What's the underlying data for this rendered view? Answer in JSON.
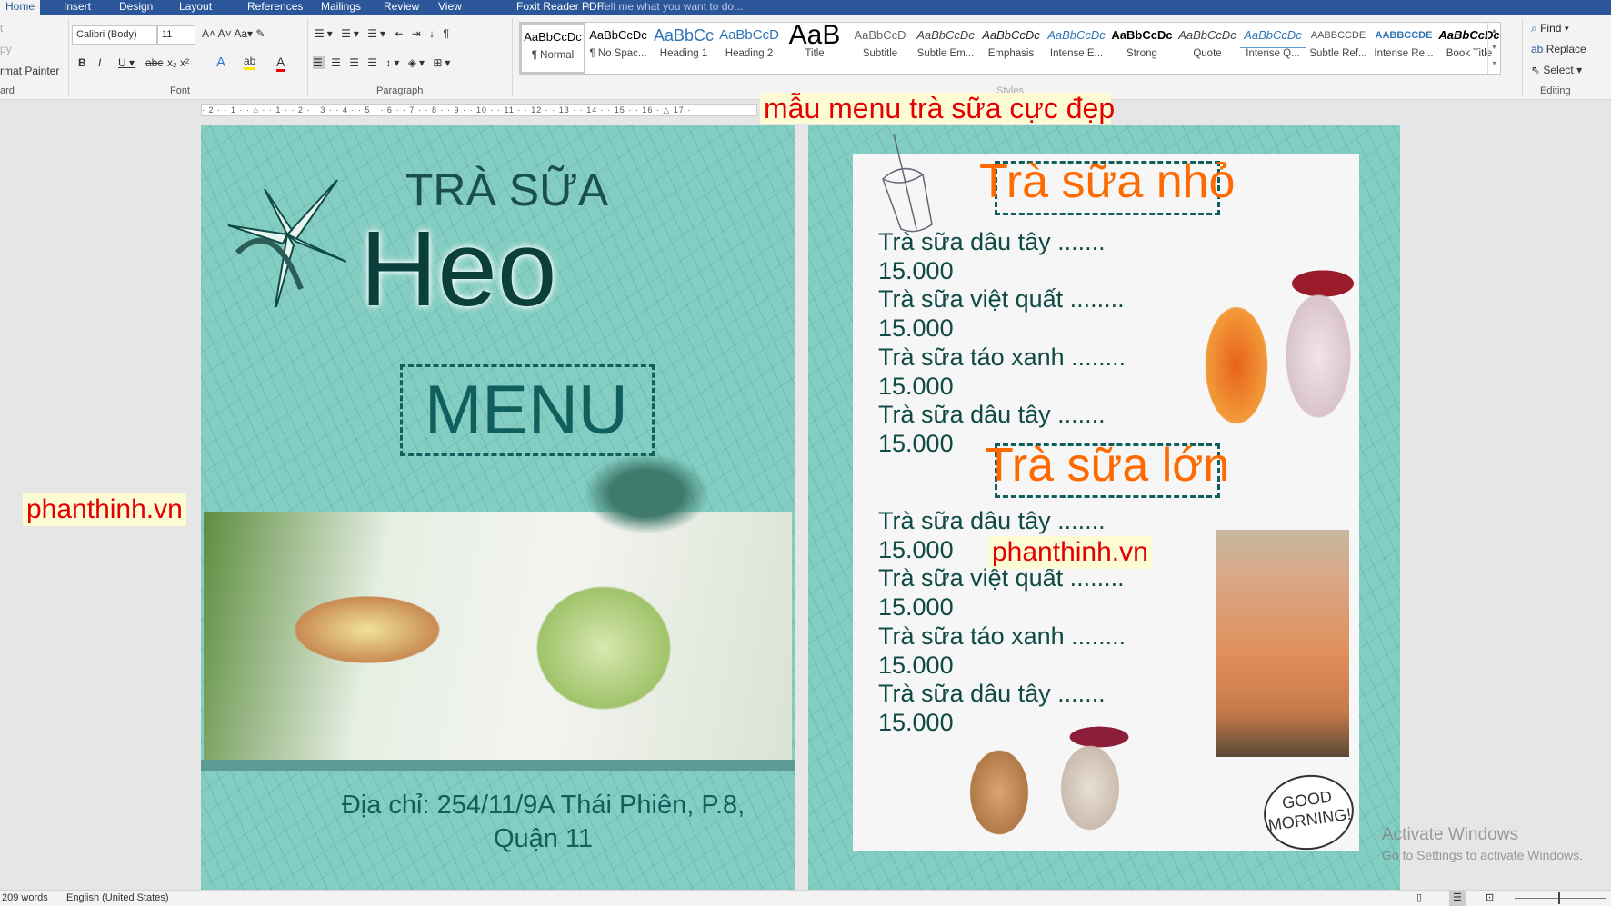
{
  "tabs": [
    "Home",
    "Insert",
    "Design",
    "Layout",
    "References",
    "Mailings",
    "Review",
    "View",
    "Foxit Reader PDF"
  ],
  "tell_me": "Tell me what you want to do...",
  "clipboard": {
    "cut": "t",
    "copy": "py",
    "format_painter": "rmat Painter",
    "label": "ard"
  },
  "font": {
    "name": "Calibri (Body)",
    "size": "11",
    "label": "Font"
  },
  "paragraph": {
    "label": "Paragraph"
  },
  "styles": {
    "label": "Styles",
    "items": [
      {
        "preview": "AaBbCcDc",
        "name": "¶ Normal"
      },
      {
        "preview": "AaBbCcDc",
        "name": "¶ No Spac..."
      },
      {
        "preview": "AaBbCc",
        "name": "Heading 1"
      },
      {
        "preview": "AaBbCcD",
        "name": "Heading 2"
      },
      {
        "preview": "AaB",
        "name": "Title"
      },
      {
        "preview": "AaBbCcD",
        "name": "Subtitle"
      },
      {
        "preview": "AaBbCcDc",
        "name": "Subtle Em..."
      },
      {
        "preview": "AaBbCcDc",
        "name": "Emphasis"
      },
      {
        "preview": "AaBbCcDc",
        "name": "Intense E..."
      },
      {
        "preview": "AaBbCcDc",
        "name": "Strong"
      },
      {
        "preview": "AaBbCcDc",
        "name": "Quote"
      },
      {
        "preview": "AaBbCcDc",
        "name": "Intense Q..."
      },
      {
        "preview": "AABBCCDE",
        "name": "Subtle Ref..."
      },
      {
        "preview": "AABBCCDE",
        "name": "Intense Re..."
      },
      {
        "preview": "AaBbCcDc",
        "name": "Book Title"
      }
    ]
  },
  "editing": {
    "find": "Find",
    "replace": "Replace",
    "select": "Select",
    "label": "Editing"
  },
  "ruler": "· 2 · · 1 · · ⌂ · · 1 · · 2 · · 3 · · 4 · · 5 · · 6 · · 7 · · 8 · · 9 · · 10 · · 11 · · 12 · · 13 · · 14 · · 15 · · 16 · △ 17 ·",
  "overlay_title": "mẫu menu trà sữa cực đẹp",
  "watermark": "phanthinh.vn",
  "left_page": {
    "title_small": "TRÀ SỮA",
    "title_big": "Heo",
    "menu": "MENU",
    "address_1": "Địa chỉ: 254/11/9A Thái Phiên, P.8,",
    "address_2": "Quận 11"
  },
  "right_page": {
    "small_heading": "Trà sữa nhỏ",
    "large_heading": "Trà sữa lớn",
    "small_items": [
      {
        "name": "Trà sữa dâu tây    .......",
        "price": "15.000"
      },
      {
        "name": "Trà sữa việt quất ........",
        "price": "15.000"
      },
      {
        "name": "Trà sữa táo xanh ........",
        "price": "15.000"
      },
      {
        "name": "Trà sữa dâu tây    .......",
        "price": "15.000"
      }
    ],
    "large_items": [
      {
        "name": "Trà sữa dâu tây    .......",
        "price": "15.000"
      },
      {
        "name": "Trà sữa việt quất ........",
        "price": "15.000"
      },
      {
        "name": "Trà sữa táo xanh ........",
        "price": "15.000"
      },
      {
        "name": "Trà sữa dâu tây    .......",
        "price": "15.000"
      }
    ],
    "good_morning": "GOOD MORNING!"
  },
  "activate": {
    "line1": "Activate Windows",
    "line2": "Go to Settings to activate Windows."
  },
  "status": {
    "words": "209 words",
    "language": "English (United States)"
  },
  "colors": {
    "ribbon_blue": "#2b579a",
    "page_teal": "#83cdc3",
    "heading_orange": "#ff6a00",
    "text_teal": "#0f4a45",
    "watermark_red": "#e30000"
  }
}
